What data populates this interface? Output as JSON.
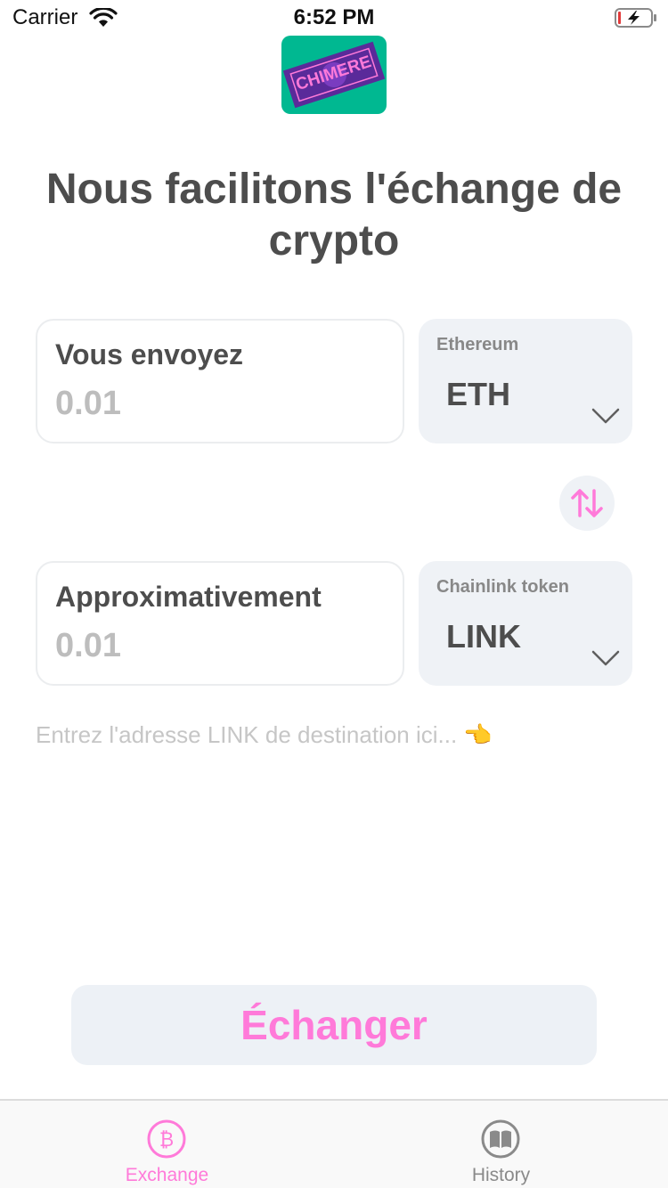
{
  "status_bar": {
    "carrier": "Carrier",
    "time": "6:52 PM"
  },
  "logo": {
    "text": "CHIMERE"
  },
  "headline": "Nous facilitons l'échange de crypto",
  "send": {
    "label": "Vous envoyez",
    "value": "0.01",
    "currency_name": "Ethereum",
    "currency_ticker": "ETH"
  },
  "receive": {
    "label": "Approximativement",
    "value": "0.01",
    "currency_name": "Chainlink token",
    "currency_ticker": "LINK"
  },
  "address": {
    "placeholder": "Entrez l'adresse LINK de destination ici... 👈"
  },
  "exchange_button": {
    "label": "Échanger"
  },
  "tabs": [
    {
      "label": "Exchange",
      "icon": "bitcoin-icon",
      "active": true
    },
    {
      "label": "History",
      "icon": "book-icon",
      "active": false
    }
  ],
  "colors": {
    "accent": "#ff7ad9",
    "text": "#4d4d4d",
    "muted": "#bdbdbd",
    "panel": "#eff2f6",
    "logo_bg": "#00b891",
    "logo_band": "#5a2a9a"
  }
}
